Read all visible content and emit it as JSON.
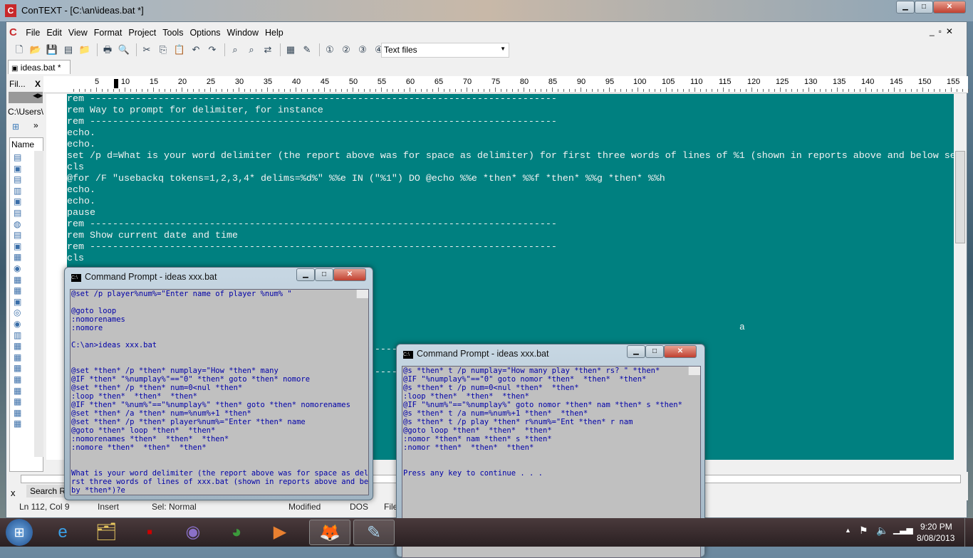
{
  "window": {
    "title": "ConTEXT - [C:\\an\\ideas.bat *]"
  },
  "menu": [
    "File",
    "Edit",
    "View",
    "Format",
    "Project",
    "Tools",
    "Options",
    "Window",
    "Help"
  ],
  "toolbar": {
    "icons": [
      "new-file-icon",
      "open-icon",
      "save-icon",
      "save-all-icon",
      "open-folder-icon",
      "print-icon",
      "print-preview-icon",
      "cut-icon",
      "copy-icon",
      "paste-icon",
      "undo-icon",
      "redo-icon",
      "find-icon",
      "find-next-icon",
      "replace-icon",
      "export-icon",
      "pin-icon",
      "user1-icon",
      "user2-icon",
      "user3-icon",
      "user4-icon"
    ],
    "filetype": "Text files"
  },
  "tab": {
    "label": "ideas.bat *"
  },
  "ruler": {
    "labels": [
      "5",
      "10",
      "15",
      "20",
      "25",
      "30",
      "35",
      "40",
      "45",
      "50",
      "55",
      "60",
      "65",
      "70",
      "75",
      "80",
      "85",
      "90",
      "95",
      "100",
      "105",
      "110",
      "115",
      "120",
      "125",
      "130",
      "135",
      "140",
      "145",
      "150",
      "155"
    ]
  },
  "file_panel": {
    "title": "Fil...",
    "close": "X",
    "path": "C:\\Users\\",
    "more": "»",
    "column": "Name"
  },
  "editor": {
    "lines": [
      "rem ----------------------------------------------------------------------------------",
      "rem Way to prompt for delimiter, for instance",
      "rem ----------------------------------------------------------------------------------",
      "echo.",
      "echo.",
      "set /p d=What is your word delimiter (the report above was for space as delimiter) for first three words of lines of %1 (shown in reports above and below se",
      "cls",
      "@for /F \"usebackq tokens=1,2,3,4* delims=%d%\" %%e IN (\"%1\") DO @echo %%e *then* %%f *then* %%g *then* %%h",
      "echo.",
      "echo.",
      "pause",
      "rem ----------------------------------------------------------------------------------",
      "rem Show current date and time",
      "rem ----------------------------------------------------------------------------------",
      "cls",
      "",
      "",
      "",
      "",
      "",
      "",
      "",
      "rem ----------------------------------------------------------------------------------",
      "",
      "rem ----------------------------------------------------------------------------------"
    ],
    "stray_char": "a"
  },
  "search_panel": {
    "close": "x",
    "tab": "Search Re"
  },
  "status": {
    "position": "Ln 112, Col 9",
    "mode": "Insert",
    "sel": "Sel: Normal",
    "modified": "Modified",
    "format": "DOS",
    "file": "File"
  },
  "cmd1": {
    "title": "Command Prompt - ideas  xxx.bat",
    "lines": [
      "@set /p player%num%=\"Enter name of player %num% \"",
      "",
      "@goto loop",
      ":nomorenames",
      ":nomore",
      "",
      "C:\\an>ideas xxx.bat",
      "",
      "",
      "@set *then* /p *then* numplay=\"How *then* many",
      "@IF *then* \"%numplay%\"==\"0\" *then* goto *then* nomore",
      "@set *then* /p *then* num=0<nul *then*",
      ":loop *then*  *then*  *then*",
      "@IF *then* \"%num%\"==\"%numplay%\" *then* goto *then* nomorenames",
      "@set *then* /a *then* num=%num%+1 *then*",
      "@set *then* /p *then* player%num%=\"Enter *then* name",
      "@goto *then* loop *then*  *then*",
      ":nomorenames *then*  *then*  *then*",
      ":nomore *then*  *then*  *then*",
      "",
      "",
      "What is your word delimiter (the report above was for space as delimiter) for fi",
      "rst three words of lines of xxx.bat (shown in reports above and below separated",
      "by *then*)?e"
    ]
  },
  "cmd2": {
    "title": "Command Prompt - ideas  xxx.bat",
    "lines": [
      "@s *then* t /p numplay=\"How many play *then* rs? \" *then*",
      "@IF \"%numplay%\"==\"0\" goto nomor *then*  *then*  *then*",
      "@s *then* t /p num=0<nul *then*  *then*",
      ":loop *then*  *then*  *then*",
      "@IF \"%num%\"==\"%numplay%\" goto nomor *then* nam *then* s *then*",
      "@s *then* t /a num=%num%+1 *then*  *then*",
      "@s *then* t /p play *then* r%num%=\"Ent *then* r nam",
      "@goto loop *then*  *then*  *then*",
      ":nomor *then* nam *then* s *then*",
      ":nomor *then*  *then*  *then*",
      "",
      "",
      "Press any key to continue . . ."
    ]
  },
  "taskbar": {
    "apps": [
      "internet-explorer-icon",
      "file-explorer-icon",
      "terminal-app-icon",
      "eclipse-icon",
      "chrome-icon",
      "media-player-icon",
      "firefox-icon",
      "notepad-icon"
    ],
    "time": "9:20 PM",
    "date": "8/08/2013"
  },
  "colors": {
    "editor_bg": "#008080",
    "editor_fg": "#f2f2f2",
    "cmd_bg": "#c0c0c0",
    "cmd_fg": "#0000a8"
  }
}
